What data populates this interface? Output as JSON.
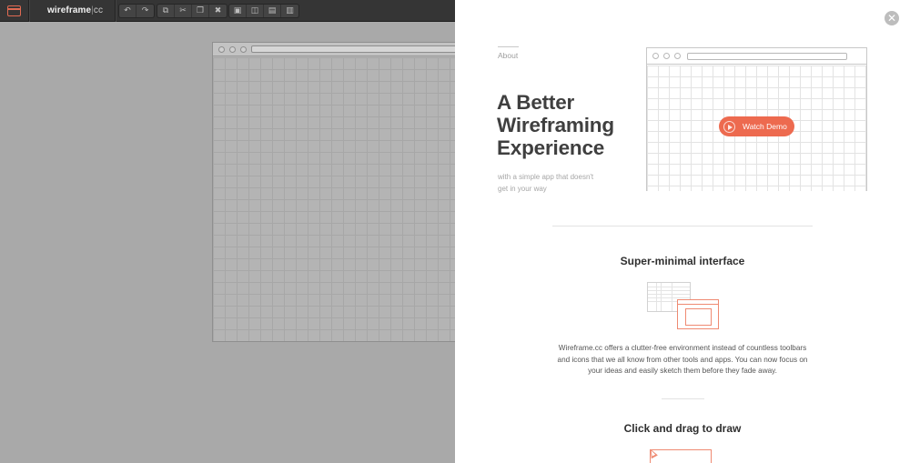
{
  "toolbar": {
    "brand_name": "wireframe",
    "brand_divider": "|",
    "brand_suffix": "cc",
    "history_buttons": [
      {
        "icon": "undo-icon",
        "glyph": "↶"
      },
      {
        "icon": "redo-icon",
        "glyph": "↷"
      }
    ],
    "edit_buttons": [
      {
        "icon": "duplicate-icon",
        "glyph": "⧉"
      },
      {
        "icon": "cut-icon",
        "glyph": "✂"
      },
      {
        "icon": "copy-icon",
        "glyph": "❐"
      },
      {
        "icon": "delete-icon",
        "glyph": "✖"
      }
    ],
    "arrange_buttons": [
      {
        "icon": "lock-icon",
        "glyph": "▣"
      },
      {
        "icon": "group-icon",
        "glyph": "◫"
      },
      {
        "icon": "send-back-icon",
        "glyph": "▤"
      },
      {
        "icon": "bring-front-icon",
        "glyph": "▥"
      }
    ]
  },
  "panel": {
    "close_glyph": "✕",
    "about_label": "About",
    "hero_title": "A Better Wireframing Experience",
    "hero_subtitle": "with a simple app that doesn't get in your way",
    "demo_button_label": "Watch Demo",
    "features": [
      {
        "title": "Super-minimal interface",
        "text": "Wireframe.cc offers a clutter-free environment instead of countless toolbars and icons that we all know from other tools and apps. You can now focus on your ideas and easily sketch them before they fade away."
      },
      {
        "title": "Click and drag to draw",
        "text": ""
      }
    ]
  },
  "colors": {
    "accent": "#ed6a4f",
    "toolbar_bg": "#353535",
    "canvas_bg": "#a9a9a9"
  }
}
